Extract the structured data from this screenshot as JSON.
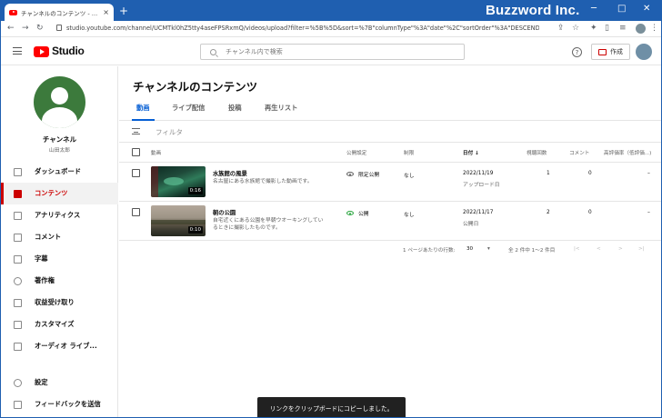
{
  "browser": {
    "tab_title": "チャンネルのコンテンツ - YouTube Stu",
    "tab_close": "×",
    "new_tab": "+",
    "url": "studio.youtube.com/channel/UCMTkl0hZ5tty4aseFPSRxmQ/videos/upload?filter=%5B%5D&sort=%7B\"columnType\"%3A\"date\"%2C\"sortOrder\"%3A\"DESCENDING\"%7D",
    "watermark": "Buzzword Inc.",
    "window_controls": [
      "─",
      "□",
      "✕"
    ]
  },
  "studio": {
    "logo_text": "Studio",
    "search_placeholder": "チャンネル内で検索",
    "help_label": "?",
    "create_label": "作成"
  },
  "channel": {
    "title": "チャンネル",
    "name": "山田太郎"
  },
  "sidebar": {
    "items": [
      {
        "label": "ダッシュボード",
        "icon": "dashboard-icon"
      },
      {
        "label": "コンテンツ",
        "icon": "content-icon",
        "active": true
      },
      {
        "label": "アナリティクス",
        "icon": "analytics-icon"
      },
      {
        "label": "コメント",
        "icon": "comments-icon"
      },
      {
        "label": "字幕",
        "icon": "subtitles-icon"
      },
      {
        "label": "著作権",
        "icon": "copyright-icon"
      },
      {
        "label": "収益受け取り",
        "icon": "monetization-icon"
      },
      {
        "label": "カスタマイズ",
        "icon": "customize-icon"
      },
      {
        "label": "オーディオ ライブ...",
        "icon": "audio-library-icon"
      }
    ],
    "bottom": [
      {
        "label": "設定",
        "icon": "settings-icon"
      },
      {
        "label": "フィードバックを送信",
        "icon": "feedback-icon"
      }
    ]
  },
  "content": {
    "page_title": "チャンネルのコンテンツ",
    "tabs": [
      "動画",
      "ライブ配信",
      "投稿",
      "再生リスト"
    ],
    "filter_placeholder": "フィルタ",
    "columns": {
      "video": "動画",
      "visibility": "公開設定",
      "restrictions": "制限",
      "date": "日付 ↓",
      "views": "視聴回数",
      "comments": "コメント",
      "likes": "高評価率（低評価...)"
    },
    "videos": [
      {
        "title": "水族館の風景",
        "description": "名古屋にある水族館で撮影した動画です。",
        "duration": "0:16",
        "visibility": "限定公開",
        "restrictions": "なし",
        "date": "2022/11/19",
        "date_status": "アップロード日",
        "views": "1",
        "comments": "0",
        "likes": "–"
      },
      {
        "title": "朝の公園",
        "description": "自宅近くにある公園を早朝ウオーキングしているときに撮影したものです。",
        "duration": "0:10",
        "visibility": "公開",
        "restrictions": "なし",
        "date": "2022/11/17",
        "date_status": "公開日",
        "views": "2",
        "comments": "0",
        "likes": "–"
      }
    ],
    "pagination": {
      "rows_label": "1 ページあたりの行数:",
      "rows_value": "30",
      "range": "全 2 件中 1～2 件目"
    }
  },
  "toast": "リンクをクリップボードにコピーしました。"
}
